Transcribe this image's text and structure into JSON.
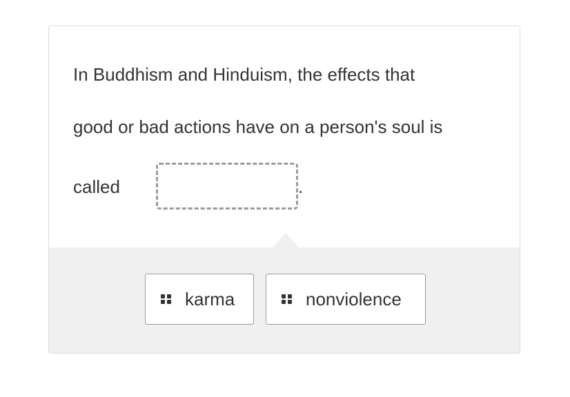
{
  "question": {
    "line1": "In Buddhism and Hinduism, the effects that",
    "line2": "good or bad actions have on a person's soul is",
    "line3_prefix": "called",
    "line3_suffix": "."
  },
  "answer_blank": {
    "value": ""
  },
  "options": [
    {
      "label": "karma",
      "icon": "drag-handle-icon"
    },
    {
      "label": "nonviolence",
      "icon": "drag-handle-icon"
    }
  ],
  "colors": {
    "text": "#333333",
    "tray_background": "#f0f0f0",
    "border": "#9a9a9a",
    "card_border": "#dcdcdc"
  }
}
